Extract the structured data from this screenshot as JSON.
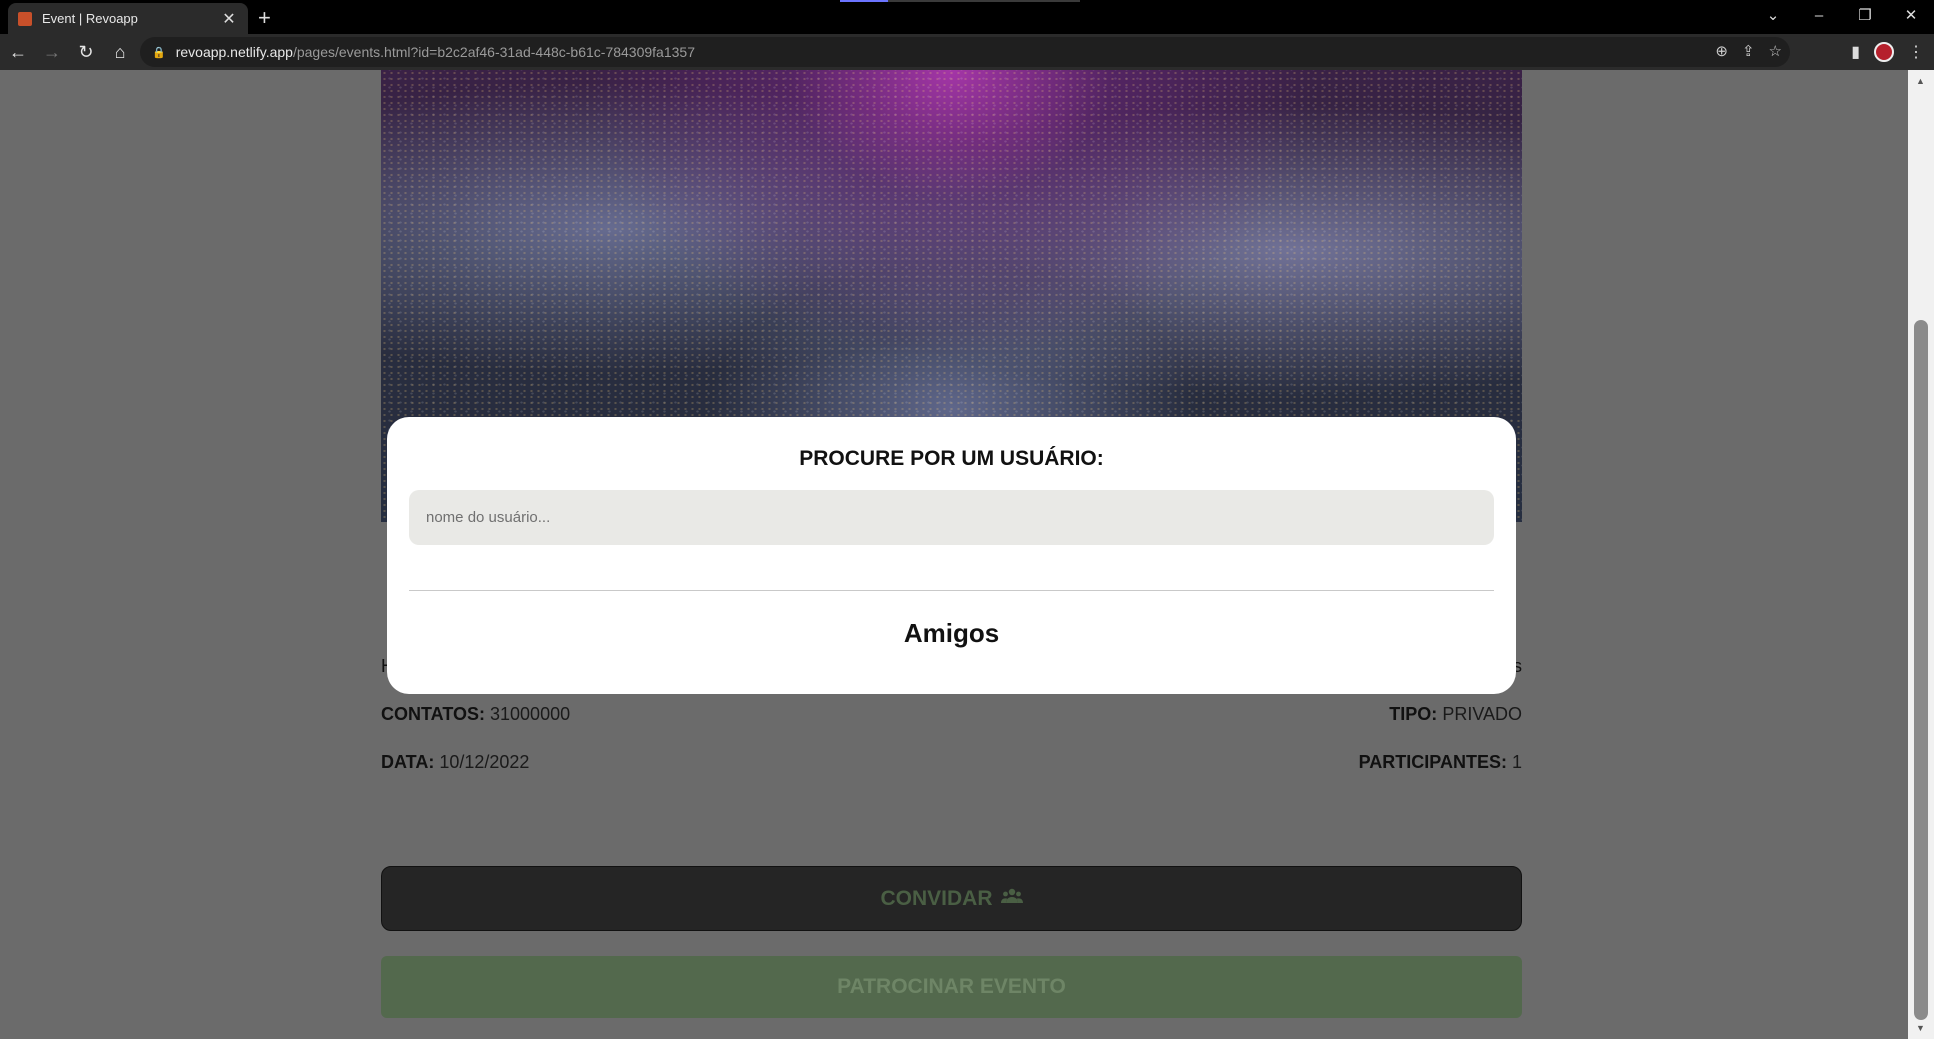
{
  "browser": {
    "tab_title": "Event | Revoapp",
    "tab_close": "✕",
    "new_tab": "+",
    "url_host": "revoapp.netlify.app",
    "url_path": "/pages/events.html?id=b2c2af46-31ad-448c-b61c-784309fa1357"
  },
  "event": {
    "contacts_label": "CONTATOS:",
    "contacts_value": "31000000",
    "type_label": "TIPO:",
    "type_value": "PRIVADO",
    "date_label": "DATA:",
    "date_value": "10/12/2022",
    "participants_label": "PARTICIPANTES:",
    "participants_value": "1",
    "partial_left": "H",
    "partial_right": "s"
  },
  "buttons": {
    "invite_label": "CONVIDAR",
    "sponsor_label": "PATROCINAR EVENTO"
  },
  "modal": {
    "title": "PROCURE POR UM USUÁRIO:",
    "search_placeholder": "nome do usuário...",
    "friends_heading": "Amigos"
  },
  "icons": {
    "invite": "users-icon",
    "lock": "lock-icon"
  },
  "colors": {
    "overlay": "#6b6b6b",
    "invite_button": "#252525",
    "sponsor_button": "#53694d"
  }
}
